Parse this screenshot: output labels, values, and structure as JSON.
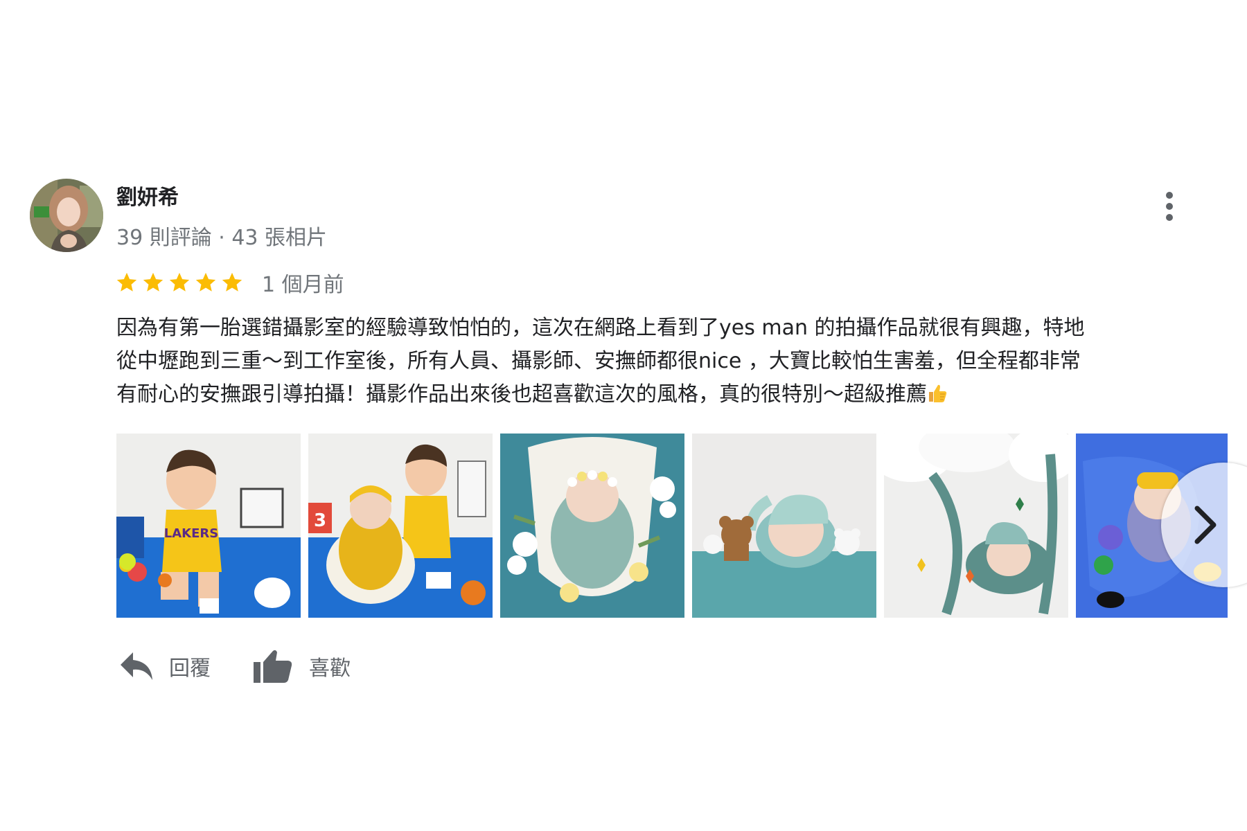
{
  "reviewer": {
    "name": "劉妍希",
    "meta": "39 則評論 · 43 張相片",
    "avatar_icon": "avatar-photo"
  },
  "rating": {
    "stars": 5,
    "max_stars": 5,
    "star_color": "#fbbc04",
    "time": "1 個月前"
  },
  "review": {
    "lines": [
      "因為有第一胎選錯攝影室的經驗導致怕怕的，這次在網路上看到了yes man 的拍攝作品就很有興趣，特地",
      "從中壢跑到三重～到工作室後，所有人員、攝影師、安撫師都很nice ，大寶比較怕生害羞，但全程都非常",
      "有耐心的安撫跟引導拍攝！攝影作品出來後也超喜歡這次的風格，真的很特別～超級推薦"
    ],
    "emoji": "thumbs-up-emoji"
  },
  "photos": [
    {
      "icon": "toddler-lakers-jersey-photo"
    },
    {
      "icon": "toddler-with-newborn-photo"
    },
    {
      "icon": "newborn-flower-crown-photo"
    },
    {
      "icon": "newborn-sleeping-hat-photo"
    },
    {
      "icon": "newborn-wrapped-hammock-photo"
    },
    {
      "icon": "newborn-diver-costume-photo"
    }
  ],
  "actions": {
    "reply_label": "回覆",
    "like_label": "喜歡"
  },
  "icons": {
    "more": "more-vert-icon",
    "next": "chevron-right-icon",
    "reply": "reply-icon",
    "like": "thumb-up-icon"
  },
  "colors": {
    "text_primary": "#202124",
    "text_secondary": "#70757a",
    "icon_gray": "#5f6368"
  }
}
